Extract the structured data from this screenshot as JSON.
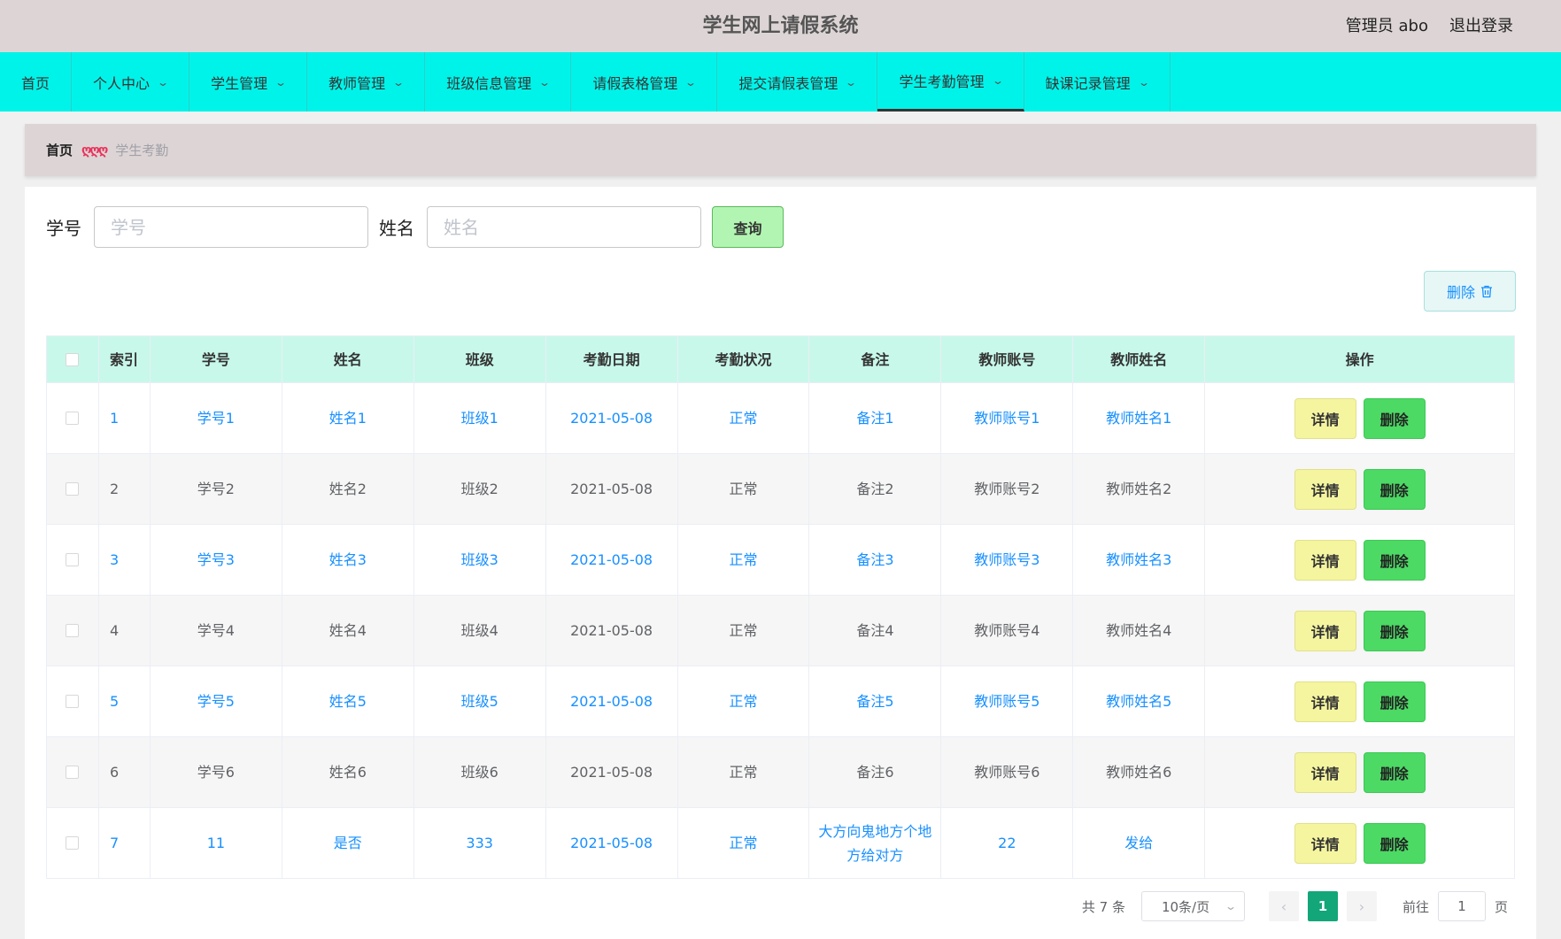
{
  "header": {
    "title": "学生网上请假系统",
    "user": "管理员 abo",
    "logout": "退出登录"
  },
  "nav": {
    "items": [
      {
        "label": "首页",
        "dropdown": false
      },
      {
        "label": "个人中心",
        "dropdown": true
      },
      {
        "label": "学生管理",
        "dropdown": true
      },
      {
        "label": "教师管理",
        "dropdown": true
      },
      {
        "label": "班级信息管理",
        "dropdown": true
      },
      {
        "label": "请假表格管理",
        "dropdown": true
      },
      {
        "label": "提交请假表管理",
        "dropdown": true
      },
      {
        "label": "学生考勤管理",
        "dropdown": true
      },
      {
        "label": "缺课记录管理",
        "dropdown": true
      }
    ],
    "active_index": 7
  },
  "breadcrumb": {
    "home": "首页",
    "separator": "ღღღ",
    "current": "学生考勤"
  },
  "search": {
    "student_no_label": "学号",
    "student_no_placeholder": "学号",
    "name_label": "姓名",
    "name_placeholder": "姓名",
    "query_button": "查询"
  },
  "toolbar": {
    "delete_label": "删除"
  },
  "table": {
    "columns": [
      "索引",
      "学号",
      "姓名",
      "班级",
      "考勤日期",
      "考勤状况",
      "备注",
      "教师账号",
      "教师姓名",
      "操作"
    ],
    "rows": [
      {
        "index": "1",
        "student_no": "学号1",
        "name": "姓名1",
        "class": "班级1",
        "date": "2021-05-08",
        "status": "正常",
        "note": "备注1",
        "teacher_account": "教师账号1",
        "teacher_name": "教师姓名1"
      },
      {
        "index": "2",
        "student_no": "学号2",
        "name": "姓名2",
        "class": "班级2",
        "date": "2021-05-08",
        "status": "正常",
        "note": "备注2",
        "teacher_account": "教师账号2",
        "teacher_name": "教师姓名2"
      },
      {
        "index": "3",
        "student_no": "学号3",
        "name": "姓名3",
        "class": "班级3",
        "date": "2021-05-08",
        "status": "正常",
        "note": "备注3",
        "teacher_account": "教师账号3",
        "teacher_name": "教师姓名3"
      },
      {
        "index": "4",
        "student_no": "学号4",
        "name": "姓名4",
        "class": "班级4",
        "date": "2021-05-08",
        "status": "正常",
        "note": "备注4",
        "teacher_account": "教师账号4",
        "teacher_name": "教师姓名4"
      },
      {
        "index": "5",
        "student_no": "学号5",
        "name": "姓名5",
        "class": "班级5",
        "date": "2021-05-08",
        "status": "正常",
        "note": "备注5",
        "teacher_account": "教师账号5",
        "teacher_name": "教师姓名5"
      },
      {
        "index": "6",
        "student_no": "学号6",
        "name": "姓名6",
        "class": "班级6",
        "date": "2021-05-08",
        "status": "正常",
        "note": "备注6",
        "teacher_account": "教师账号6",
        "teacher_name": "教师姓名6"
      },
      {
        "index": "7",
        "student_no": "11",
        "name": "是否",
        "class": "333",
        "date": "2021-05-08",
        "status": "正常",
        "note": "大方向鬼地方个地方给对方",
        "teacher_account": "22",
        "teacher_name": "发给"
      }
    ],
    "detail_label": "详情",
    "delete_label": "删除"
  },
  "pagination": {
    "total": "共 7 条",
    "page_size": "10条/页",
    "current_page": "1",
    "goto_label": "前往",
    "goto_value": "1",
    "page_suffix": "页"
  },
  "colors": {
    "navbar": "#00f3e9",
    "header": "#ddd5d5",
    "table_header": "#c8f8ea",
    "link_blue": "#1890ff",
    "detail_button": "#f5f5a0",
    "delete_button": "#4cd964",
    "pager_active": "#13a679"
  },
  "icons": {
    "dropdown": "chevron-down-icon",
    "trash": "trash-icon",
    "prev": "chevron-left-icon",
    "next": "chevron-right-icon"
  }
}
